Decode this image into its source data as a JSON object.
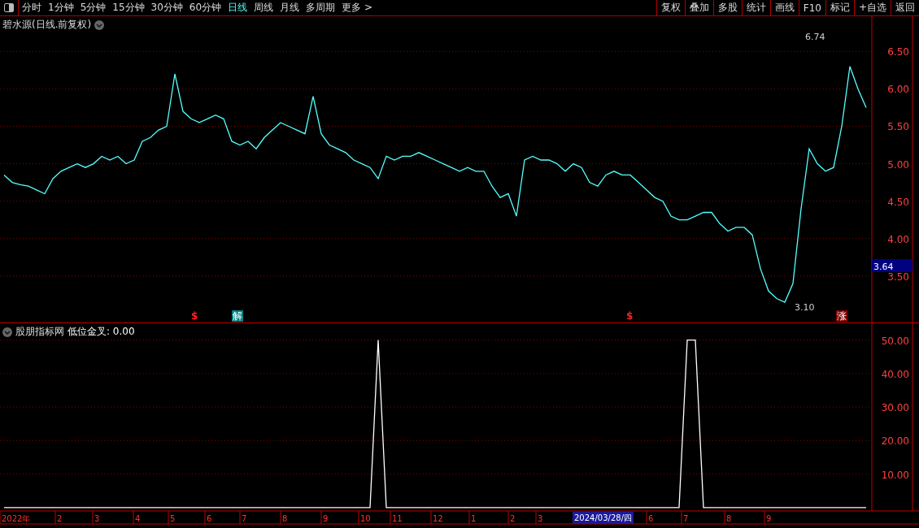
{
  "toolbar": {
    "periods": [
      {
        "label": "分时",
        "selected": false
      },
      {
        "label": "1分钟",
        "selected": false
      },
      {
        "label": "5分钟",
        "selected": false
      },
      {
        "label": "15分钟",
        "selected": false
      },
      {
        "label": "30分钟",
        "selected": false
      },
      {
        "label": "60分钟",
        "selected": false
      },
      {
        "label": "日线",
        "selected": true
      },
      {
        "label": "周线",
        "selected": false
      },
      {
        "label": "月线",
        "selected": false
      },
      {
        "label": "多周期",
        "selected": false
      },
      {
        "label": "更多 >",
        "selected": false
      }
    ],
    "buttons": [
      "复权",
      "叠加",
      "多股",
      "统计",
      "画线",
      "F10",
      "标记",
      "+自选",
      "返回"
    ]
  },
  "price_panel": {
    "title": "碧水源(日线.前复权)",
    "current_price": "3.64",
    "signals": [
      {
        "kind": "dollar",
        "label": "$"
      },
      {
        "kind": "jie",
        "label": "解"
      },
      {
        "kind": "dollar",
        "label": "$"
      },
      {
        "kind": "zhang",
        "label": "涨"
      }
    ],
    "price_marks": [
      "6.74",
      "3.10"
    ],
    "chart_data": {
      "type": "line",
      "grid": true,
      "ylim": [
        2.88,
        6.97
      ],
      "yticks": [
        {
          "value": 3.5,
          "label": "3.50"
        },
        {
          "value": 4,
          "label": "4.00"
        },
        {
          "value": 4.5,
          "label": "4.50"
        },
        {
          "value": 5,
          "label": "5.00"
        },
        {
          "value": 5.5,
          "label": "5.50"
        },
        {
          "value": 6,
          "label": "6.00"
        },
        {
          "value": 6.5,
          "label": "6.50"
        }
      ],
      "series": [
        {
          "color": "#54ffff",
          "values": [
            4.85,
            4.75,
            4.72,
            4.7,
            4.65,
            4.6,
            4.8,
            4.9,
            4.95,
            5.0,
            4.95,
            5.0,
            5.1,
            5.05,
            5.1,
            5.0,
            5.05,
            5.3,
            5.35,
            5.45,
            5.5,
            6.2,
            5.7,
            5.6,
            5.55,
            5.6,
            5.65,
            5.6,
            5.3,
            5.25,
            5.3,
            5.2,
            5.35,
            5.45,
            5.55,
            5.5,
            5.45,
            5.4,
            5.9,
            5.4,
            5.25,
            5.2,
            5.15,
            5.05,
            5.0,
            4.95,
            4.8,
            5.1,
            5.05,
            5.1,
            5.1,
            5.15,
            5.1,
            5.05,
            5.0,
            4.95,
            4.9,
            4.95,
            4.9,
            4.9,
            4.7,
            4.55,
            4.6,
            4.3,
            5.05,
            5.1,
            5.05,
            5.05,
            5.0,
            4.9,
            5.0,
            4.95,
            4.75,
            4.7,
            4.85,
            4.9,
            4.85,
            4.85,
            4.75,
            4.65,
            4.55,
            4.5,
            4.3,
            4.25,
            4.25,
            4.3,
            4.35,
            4.35,
            4.2,
            4.1,
            4.15,
            4.15,
            4.05,
            3.6,
            3.3,
            3.2,
            3.15,
            3.4,
            4.4,
            5.2,
            5.0,
            4.9,
            4.95,
            5.5,
            6.3,
            6.0,
            5.75
          ]
        }
      ]
    }
  },
  "indicator_panel": {
    "title": "股朋指标网",
    "formula": "低位金叉: 0.00",
    "cursor_date": "2024/03/28/四",
    "date_axis": [
      "2022年",
      "2",
      "3",
      "4",
      "5",
      "6",
      "7",
      "8",
      "9",
      "10",
      "11",
      "12",
      "1",
      "2",
      "3",
      "6",
      "7",
      "8",
      "9"
    ],
    "chart_data": {
      "type": "line",
      "grid": true,
      "ylim": [
        -1,
        55
      ],
      "yticks": [
        {
          "value": 10,
          "label": "10.00"
        },
        {
          "value": 20,
          "label": "20.00"
        },
        {
          "value": 30,
          "label": "30.00"
        },
        {
          "value": 40,
          "label": "40.00"
        },
        {
          "value": 50,
          "label": "50.00"
        }
      ],
      "series": [
        {
          "color": "#ffffff",
          "values": [
            0,
            0,
            0,
            0,
            0,
            0,
            0,
            0,
            0,
            0,
            0,
            0,
            0,
            0,
            0,
            0,
            0,
            0,
            0,
            0,
            0,
            0,
            0,
            0,
            0,
            0,
            0,
            0,
            0,
            0,
            0,
            0,
            0,
            0,
            0,
            0,
            0,
            0,
            0,
            0,
            0,
            0,
            0,
            0,
            0,
            0,
            50,
            0,
            0,
            0,
            0,
            0,
            0,
            0,
            0,
            0,
            0,
            0,
            0,
            0,
            0,
            0,
            0,
            0,
            0,
            0,
            0,
            0,
            0,
            0,
            0,
            0,
            0,
            0,
            0,
            0,
            0,
            0,
            0,
            0,
            0,
            0,
            0,
            0,
            50,
            50,
            0,
            0,
            0,
            0,
            0,
            0,
            0,
            0,
            0,
            0,
            0,
            0,
            0,
            0,
            0,
            0,
            0,
            0,
            0,
            0,
            0
          ]
        }
      ]
    }
  }
}
